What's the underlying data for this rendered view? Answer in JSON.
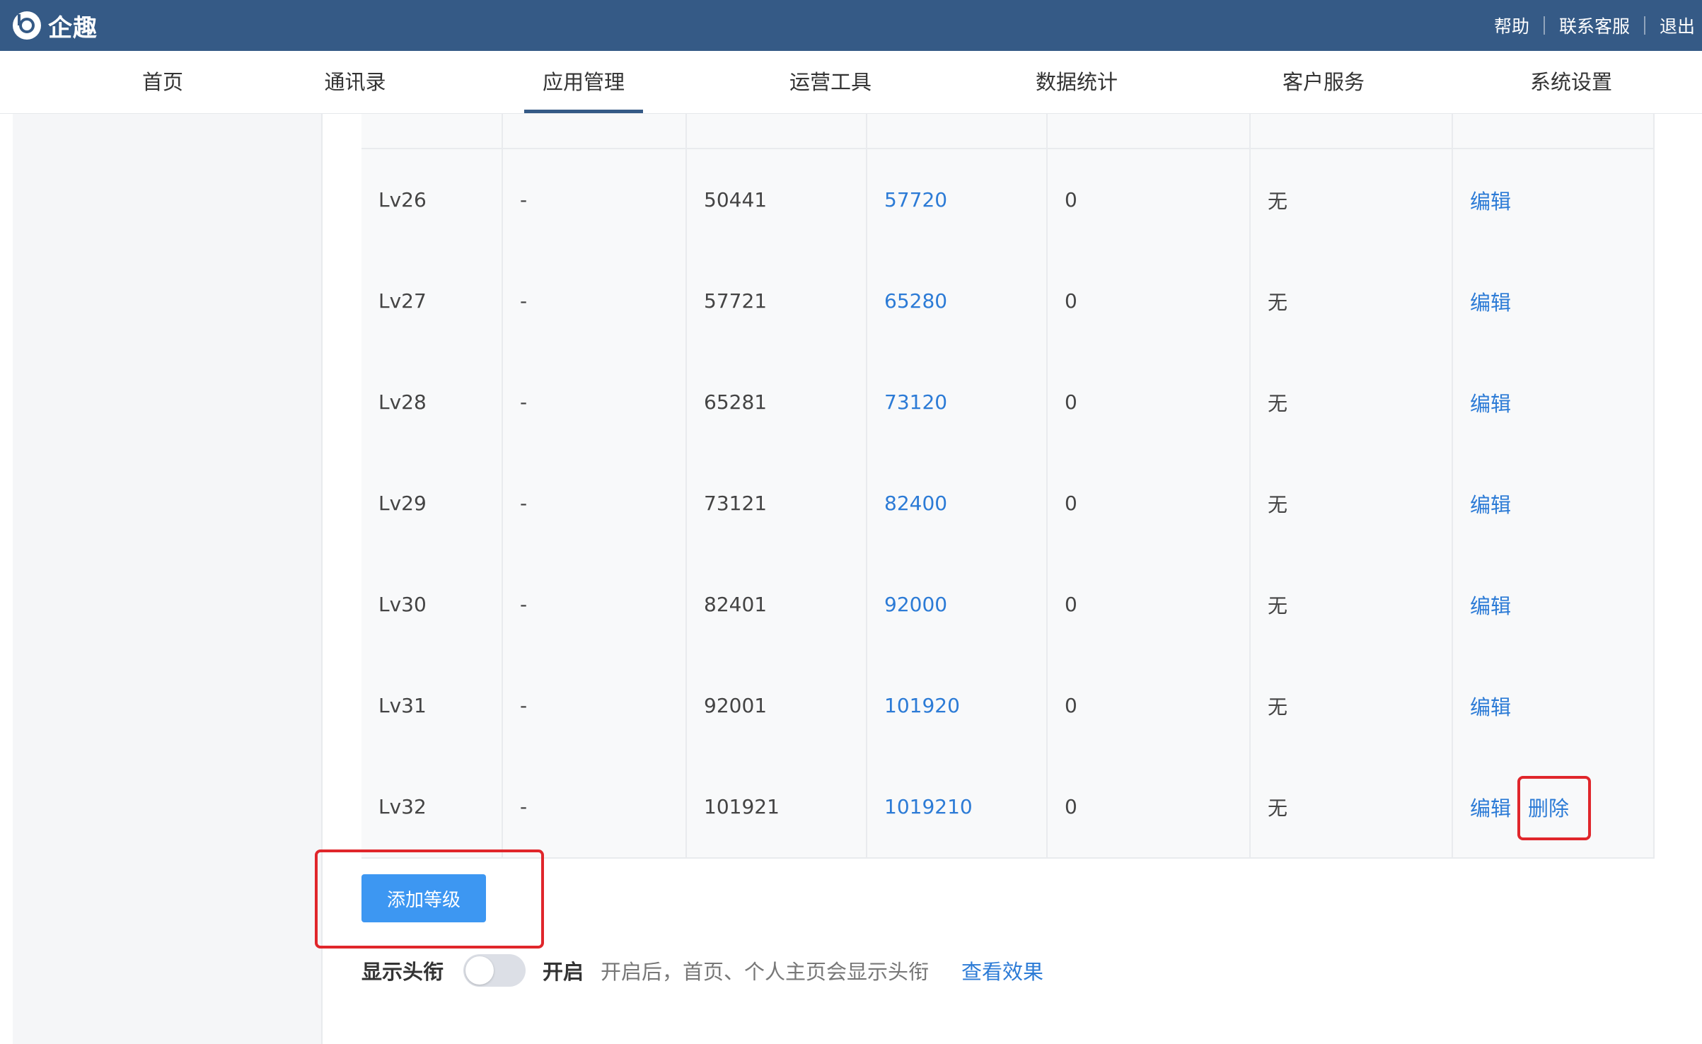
{
  "app": {
    "logo_text": "企趣",
    "colors": {
      "header_bg": "#355a86",
      "link": "#2c7bd6",
      "primary_button": "#3d97f2",
      "highlight": "#e0262b"
    }
  },
  "top_links": {
    "help": "帮助",
    "contact": "联系客服",
    "logout": "退出"
  },
  "nav": {
    "items": [
      "首页",
      "通讯录",
      "应用管理",
      "运营工具",
      "数据统计",
      "客户服务",
      "系统设置"
    ],
    "active_index": 2
  },
  "table": {
    "rows": [
      {
        "level": "Lv26",
        "name": "-",
        "min": "50441",
        "max": "57720",
        "reward": "0",
        "badge": "无",
        "actions": [
          "编辑"
        ]
      },
      {
        "level": "Lv27",
        "name": "-",
        "min": "57721",
        "max": "65280",
        "reward": "0",
        "badge": "无",
        "actions": [
          "编辑"
        ]
      },
      {
        "level": "Lv28",
        "name": "-",
        "min": "65281",
        "max": "73120",
        "reward": "0",
        "badge": "无",
        "actions": [
          "编辑"
        ]
      },
      {
        "level": "Lv29",
        "name": "-",
        "min": "73121",
        "max": "82400",
        "reward": "0",
        "badge": "无",
        "actions": [
          "编辑"
        ]
      },
      {
        "level": "Lv30",
        "name": "-",
        "min": "82401",
        "max": "92000",
        "reward": "0",
        "badge": "无",
        "actions": [
          "编辑"
        ]
      },
      {
        "level": "Lv31",
        "name": "-",
        "min": "92001",
        "max": "101920",
        "reward": "0",
        "badge": "无",
        "actions": [
          "编辑"
        ]
      },
      {
        "level": "Lv32",
        "name": "-",
        "min": "101921",
        "max": "1019210",
        "reward": "0",
        "badge": "无",
        "actions": [
          "编辑",
          "删除"
        ]
      }
    ]
  },
  "add_level_label": "添加等级",
  "badge_setting": {
    "label": "显示头衔",
    "toggle_state": "开启",
    "enabled": false,
    "description": "开启后，首页、个人主页会显示头衔",
    "view_link": "查看效果"
  }
}
